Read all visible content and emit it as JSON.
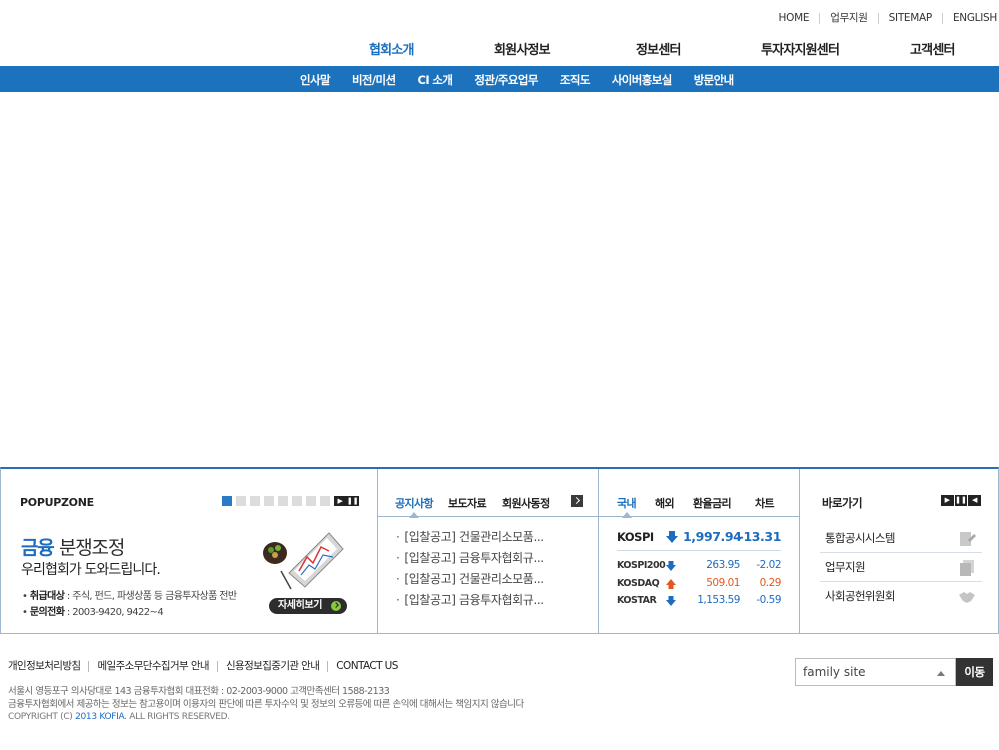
{
  "util_links": [
    "HOME",
    "업무지원",
    "SITEMAP",
    "ENGLISH"
  ],
  "gnb": [
    "협회소개",
    "회원사정보",
    "정보센터",
    "투자자지원센터",
    "고객센터"
  ],
  "subnav": [
    "인사말",
    "비전/미션",
    "CI 소개",
    "정관/주요업무",
    "조직도",
    "사이버홍보실",
    "방문안내"
  ],
  "popup": {
    "title": "POPUPZONE",
    "headline_1": "금융",
    "headline_2": "분쟁조정",
    "subline": "우리협회가 도와드립니다.",
    "item1_label": "취급대상",
    "item1_value": " : 주식, 펀드, 파생상품 등 금융투자상품 전반",
    "item2_label": "문의전화",
    "item2_value": " : 2003-9420, 9422~4",
    "more": "자세히보기"
  },
  "notice": {
    "tabs": [
      "공지사항",
      "보도자료",
      "회원사동정"
    ],
    "items": [
      "[입찰공고] 건물관리소모품...",
      "[입찰공고] 금융투자협회규...",
      "[입찰공고] 건물관리소모품...",
      "[입찰공고] 금융투자협회규..."
    ]
  },
  "market": {
    "tabs": [
      "국내",
      "해외",
      "환율금리",
      "차트"
    ],
    "main": {
      "name": "KOSPI",
      "value": "1,997.94",
      "change": "-13.31",
      "direction": "down"
    },
    "rows": [
      {
        "name": "KOSPI200",
        "value": "263.95",
        "change": "-2.02",
        "direction": "down"
      },
      {
        "name": "KOSDAQ",
        "value": "509.01",
        "change": "0.29",
        "direction": "up"
      },
      {
        "name": "KOSTAR",
        "value": "1,153.59",
        "change": "-0.59",
        "direction": "down"
      }
    ]
  },
  "quick": {
    "title": "바로가기",
    "items": [
      "통합공시시스템",
      "업무지원",
      "사회공헌위원회"
    ]
  },
  "footer": {
    "links": [
      "개인정보처리방침",
      "메일주소무단수집거부 안내",
      "신용정보집중기관 안내",
      "CONTACT US"
    ],
    "address": "서울시 영등포구 의사당대로 143 금융투자협회   대표전화 : 02-2003-9000     고객만족센터 1588-2133",
    "disclaimer": "금융투자협회에서 제공하는 정보는 참고용이며 이용자의 판단에 따른 투자수익 및 정보의 오류등에 따른 손익에 대해서는 책임지지 않습니다",
    "copyright_prefix": "COPYRIGHT (C) ",
    "copyright_brand": "2013 KOFIA",
    "copyright_suffix": ". ALL RIGHTS RESERVED.",
    "family_site": "family site",
    "go_button": "이동"
  },
  "colors": {
    "primary": "#1c72bd",
    "down": "#1e6cc0",
    "up": "#e0591f"
  }
}
